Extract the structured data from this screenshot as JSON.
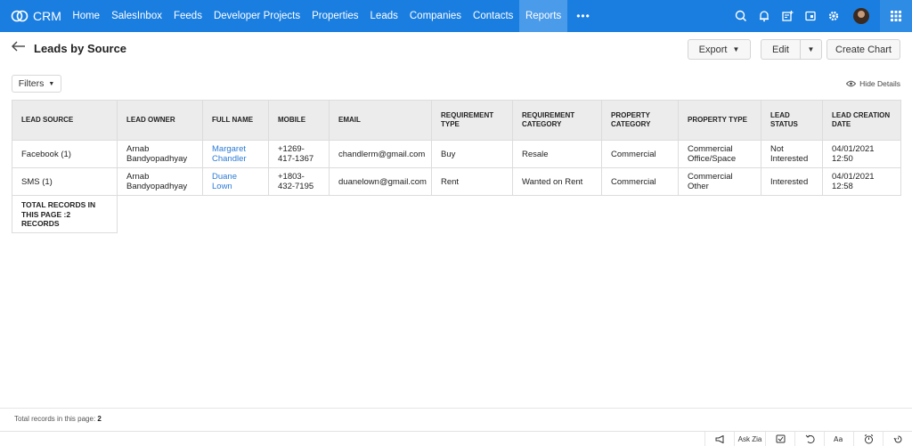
{
  "app": {
    "name": "CRM"
  },
  "nav": {
    "items": [
      {
        "label": "Home"
      },
      {
        "label": "SalesInbox"
      },
      {
        "label": "Feeds"
      },
      {
        "label": "Developer Projects"
      },
      {
        "label": "Properties"
      },
      {
        "label": "Leads"
      },
      {
        "label": "Companies"
      },
      {
        "label": "Contacts"
      },
      {
        "label": "Reports"
      }
    ],
    "more": "•••",
    "active": "Reports",
    "icons": [
      "search-icon",
      "bell-icon",
      "calendar-add-icon",
      "notes-icon",
      "settings-icon",
      "avatar",
      "apps-grid-icon"
    ]
  },
  "header": {
    "title": "Leads by Source",
    "export_label": "Export",
    "edit_label": "Edit",
    "create_chart_label": "Create Chart"
  },
  "toolbar": {
    "filters_label": "Filters",
    "hide_details_label": "Hide Details"
  },
  "table": {
    "columns": [
      "LEAD SOURCE",
      "LEAD OWNER",
      "FULL NAME",
      "MOBILE",
      "EMAIL",
      "REQUIREMENT TYPE",
      "REQUIREMENT CATEGORY",
      "PROPERTY CATEGORY",
      "PROPERTY TYPE",
      "LEAD STATUS",
      "LEAD CREATION DATE"
    ],
    "rows": [
      [
        "Facebook (1)",
        "Arnab Bandyopadhyay",
        "Margaret Chandler",
        "+1269-417-1367",
        "chandlerm@gmail.com",
        "Buy",
        "Resale",
        "Commercial",
        "Commercial Office/Space",
        "Not Interested",
        "04/01/2021 12:50"
      ],
      [
        "SMS (1)",
        "Arnab Bandyopadhyay",
        "Duane Lown",
        "+1803-432-7195",
        "duanelown@gmail.com",
        "Rent",
        "Wanted on Rent",
        "Commercial",
        "Commercial Other",
        "Interested",
        "04/01/2021 12:58"
      ]
    ],
    "total_label": "TOTAL RECORDS IN THIS PAGE :2 RECORDS"
  },
  "footer": {
    "records_label": "Total records in this page:",
    "records_count": "2",
    "ask_zia": "Ask Zia"
  }
}
